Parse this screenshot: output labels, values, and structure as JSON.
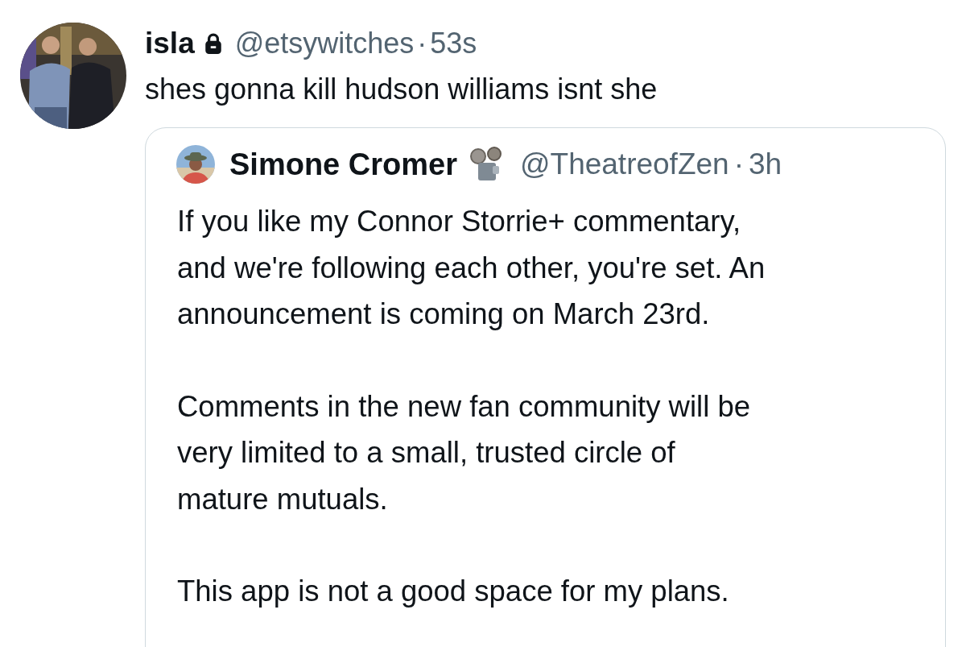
{
  "tweet": {
    "name": "isla",
    "protected": true,
    "handle": "@etsywitches",
    "separator": "·",
    "time": "53s",
    "text": "shes gonna kill hudson williams isnt she",
    "quote": {
      "name": "Simone Cromer",
      "handle": "@TheatreofZen",
      "separator": "·",
      "time": "3h",
      "paragraphs": [
        "If you like my Connor Storrie+ commentary, and we're following each other, you're set. An announcement is coming on March 23rd.",
        "Comments in the new fan community will be very limited to a small, trusted circle of mature mutuals.",
        "This app is not a good space for my plans."
      ]
    }
  }
}
